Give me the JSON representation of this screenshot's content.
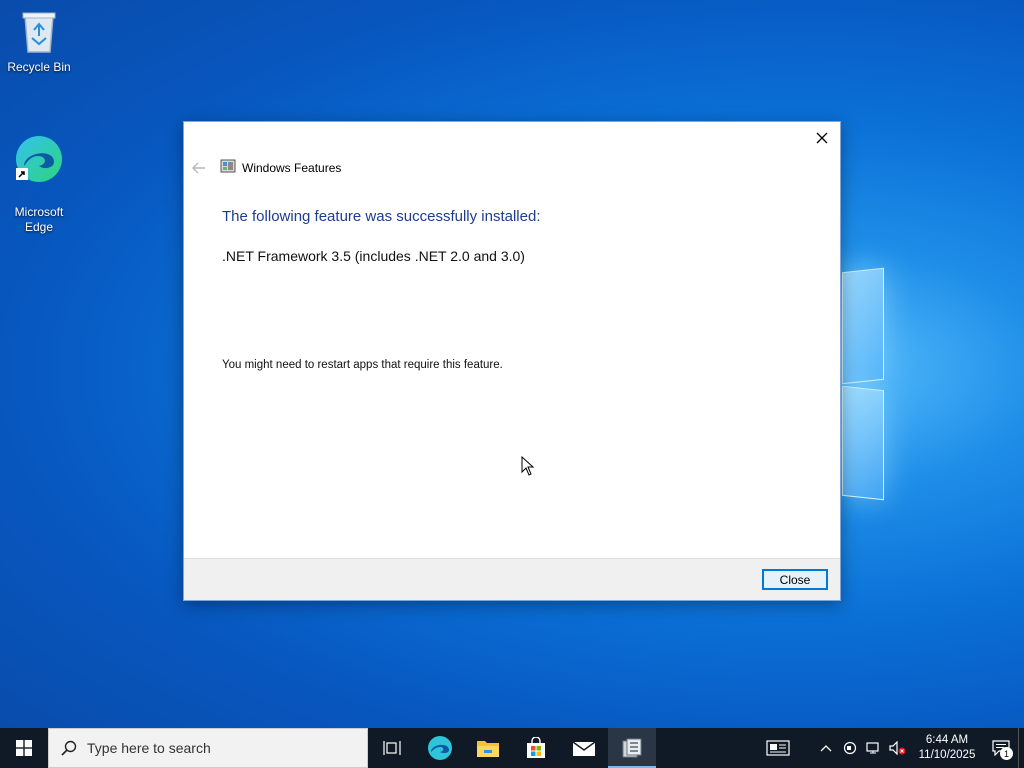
{
  "desktop": {
    "icons": [
      {
        "label": "Recycle Bin",
        "icon": "recycle-bin-icon"
      },
      {
        "label": "Microsoft\nEdge",
        "icon": "edge-icon"
      }
    ]
  },
  "dialog": {
    "title": "Windows Features",
    "heading": "The following feature was successfully installed:",
    "feature": ".NET Framework 3.5 (includes .NET 2.0 and 3.0)",
    "note": "You might need to restart apps that require this feature.",
    "close_button_label": "Close"
  },
  "taskbar": {
    "search_placeholder": "Type here to search",
    "apps": [
      "task-view-icon",
      "edge-icon",
      "file-explorer-icon",
      "microsoft-store-icon",
      "mail-icon",
      "windows-features-icon"
    ],
    "time": "6:44 AM",
    "date": "11/10/2025",
    "notification_count": "1"
  },
  "colors": {
    "heading": "#1e3d8f",
    "taskbar": "#101a26",
    "accent": "#0078d7"
  }
}
